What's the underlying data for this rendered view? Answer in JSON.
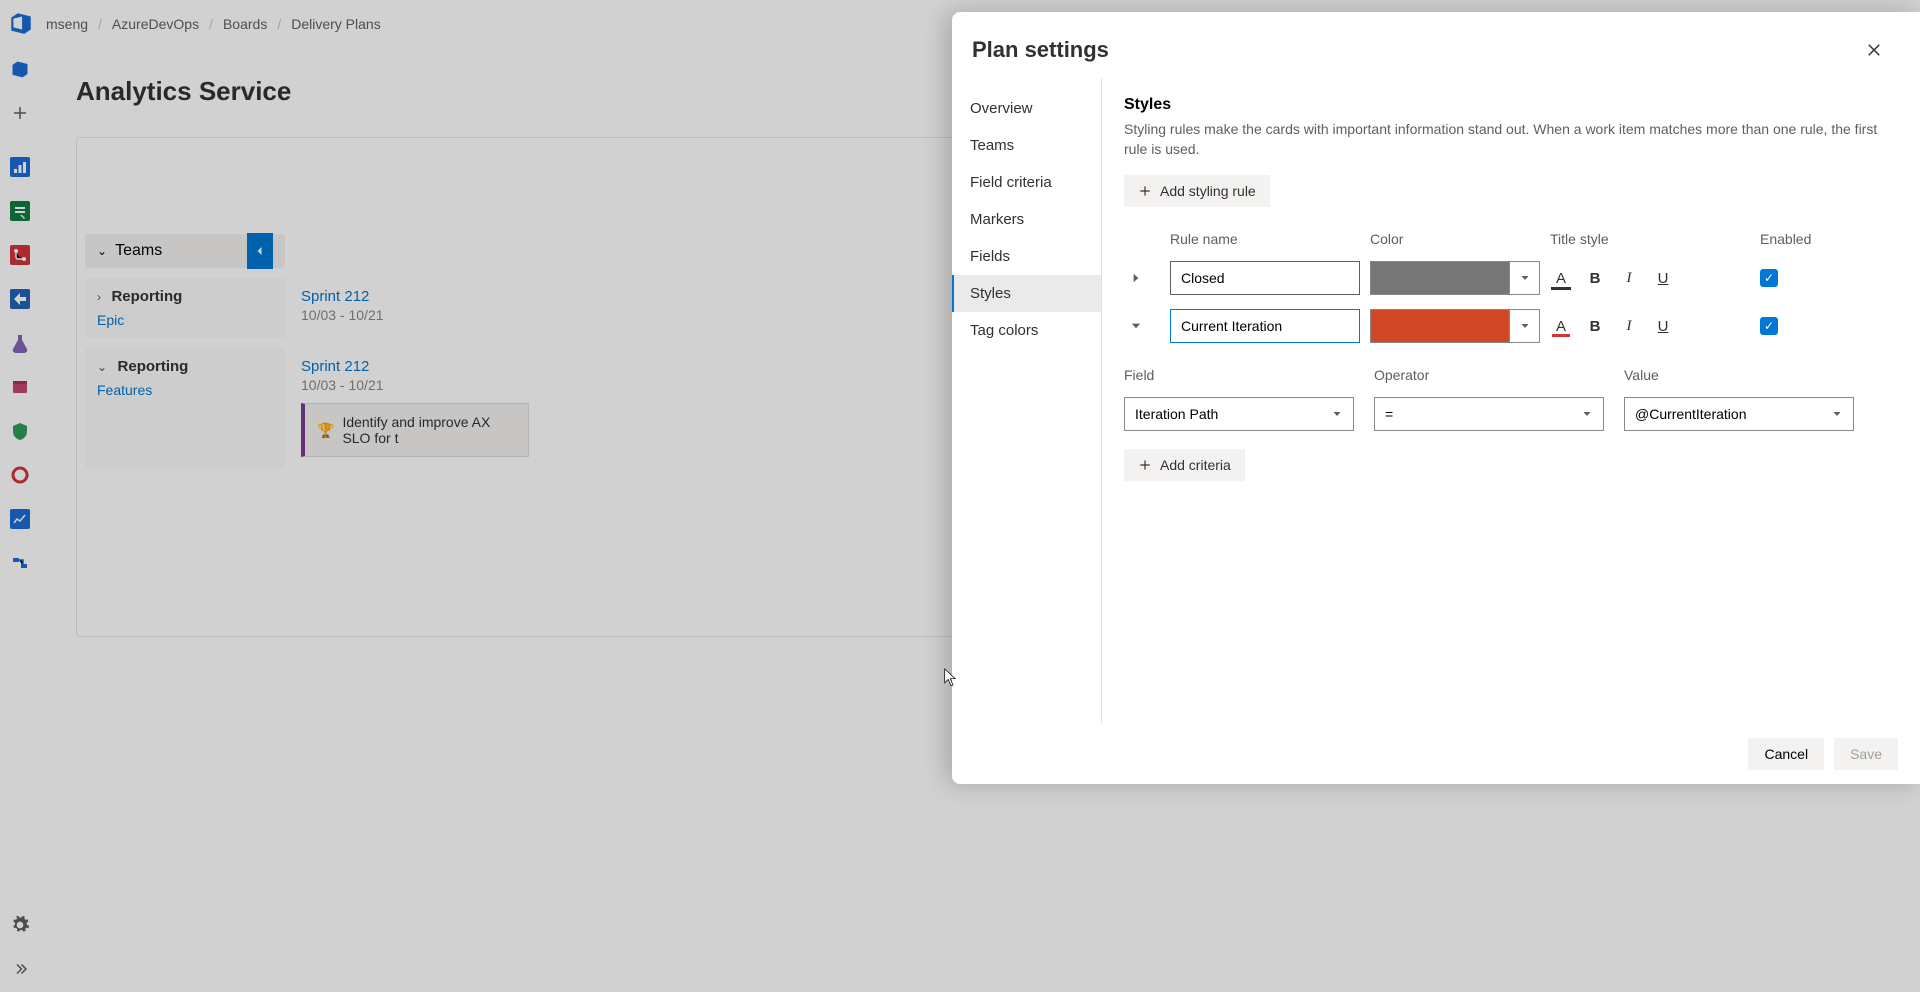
{
  "breadcrumbs": [
    "mseng",
    "AzureDevOps",
    "Boards",
    "Delivery Plans"
  ],
  "rail_icons": [
    "azuredevops",
    "plus",
    "dashboards",
    "boards",
    "repos",
    "pipelines",
    "testplans",
    "artifacts",
    "extensions",
    "experiments",
    "analytics",
    "roadmap"
  ],
  "main": {
    "title": "Analytics Service",
    "teams_header": "Teams",
    "rows": [
      {
        "name": "Reporting",
        "type": "Epic",
        "sprint": "Sprint 212",
        "dates": "10/03 - 10/21"
      },
      {
        "name": "Reporting",
        "type": "Features",
        "sprint": "Sprint 212",
        "dates": "10/03 - 10/21",
        "card": "Identify and improve AX SLO for t"
      }
    ]
  },
  "panel": {
    "title": "Plan settings",
    "nav": [
      "Overview",
      "Teams",
      "Field criteria",
      "Markers",
      "Fields",
      "Styles",
      "Tag colors"
    ],
    "nav_active": 5,
    "styles": {
      "heading": "Styles",
      "description": "Styling rules make the cards with important information stand out. When a work item matches more than one rule, the first rule is used.",
      "add_rule_label": "Add styling rule",
      "col_rule": "Rule name",
      "col_color": "Color",
      "col_title": "Title style",
      "col_enabled": "Enabled",
      "rules": [
        {
          "name": "Closed",
          "color": "#767676",
          "expanded": false,
          "enabled": true
        },
        {
          "name": "Current Iteration",
          "color": "#d24726",
          "expanded": true,
          "enabled": true
        }
      ],
      "criteria_hdr": {
        "field": "Field",
        "operator": "Operator",
        "value": "Value"
      },
      "criteria": {
        "field": "Iteration Path",
        "operator": "=",
        "value": "@CurrentIteration"
      },
      "add_criteria_label": "Add criteria"
    },
    "cancel": "Cancel",
    "save": "Save"
  }
}
